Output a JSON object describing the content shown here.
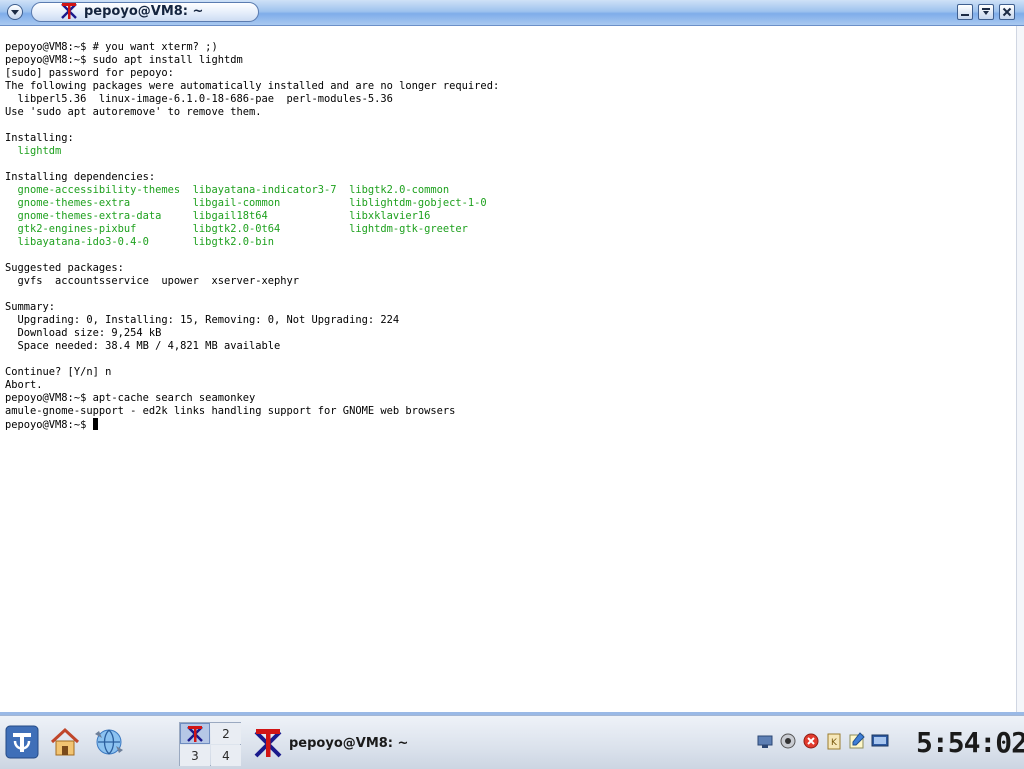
{
  "window": {
    "title": "pepoyo@VM8: ~",
    "menu_icon": "chevron-down-icon",
    "controls": [
      "minimize-icon",
      "maximize-icon",
      "close-icon"
    ]
  },
  "terminal": {
    "lines": [
      {
        "text": "pepoyo@VM8:~$ # you want xterm? ;)"
      },
      {
        "text": "pepoyo@VM8:~$ sudo apt install lightdm"
      },
      {
        "text": "[sudo] password for pepoyo:"
      },
      {
        "text": "The following packages were automatically installed and are no longer required:"
      },
      {
        "text": "  libperl5.36  linux-image-6.1.0-18-686-pae  perl-modules-5.36"
      },
      {
        "text": "Use 'sudo apt autoremove' to remove them."
      },
      {
        "text": ""
      },
      {
        "text": "Installing:"
      },
      {
        "text": "  lightdm",
        "color": "green"
      },
      {
        "text": ""
      },
      {
        "text": "Installing dependencies:"
      },
      {
        "text": "  gnome-accessibility-themes  libayatana-indicator3-7  libgtk2.0-common",
        "color": "green"
      },
      {
        "text": "  gnome-themes-extra          libgail-common           liblightdm-gobject-1-0",
        "color": "green"
      },
      {
        "text": "  gnome-themes-extra-data     libgail18t64             libxklavier16",
        "color": "green"
      },
      {
        "text": "  gtk2-engines-pixbuf         libgtk2.0-0t64           lightdm-gtk-greeter",
        "color": "green"
      },
      {
        "text": "  libayatana-ido3-0.4-0       libgtk2.0-bin",
        "color": "green"
      },
      {
        "text": ""
      },
      {
        "text": "Suggested packages:"
      },
      {
        "text": "  gvfs  accountsservice  upower  xserver-xephyr"
      },
      {
        "text": ""
      },
      {
        "text": "Summary:"
      },
      {
        "text": "  Upgrading: 0, Installing: 15, Removing: 0, Not Upgrading: 224"
      },
      {
        "text": "  Download size: 9,254 kB"
      },
      {
        "text": "  Space needed: 38.4 MB / 4,821 MB available"
      },
      {
        "text": ""
      },
      {
        "text": "Continue? [Y/n] n"
      },
      {
        "text": "Abort."
      },
      {
        "text": "pepoyo@VM8:~$ apt-cache search seamonkey"
      },
      {
        "text": "amule-gnome-support - ed2k links handling support for GNOME web browsers"
      },
      {
        "text": "pepoyo@VM8:~$ ",
        "cursor": true
      }
    ],
    "colors": {
      "foreground": "#000000",
      "green": "#1fa11f",
      "background": "#ffffff"
    }
  },
  "taskbar": {
    "launchers": [
      "kde-menu-icon",
      "home-folder-icon",
      "web-browser-icon"
    ],
    "pager": {
      "desktops": [
        "1",
        "2",
        "3",
        "4"
      ],
      "active": "1",
      "desktop1_icon": "xterm-icon"
    },
    "task": {
      "label": "pepoyo@VM8: ~",
      "icon": "xterm-icon"
    },
    "systray": [
      "network-icon",
      "mixer-icon",
      "update-icon",
      "klipper-icon",
      "notes-icon",
      "display-icon"
    ],
    "clock": "5:54:02"
  }
}
